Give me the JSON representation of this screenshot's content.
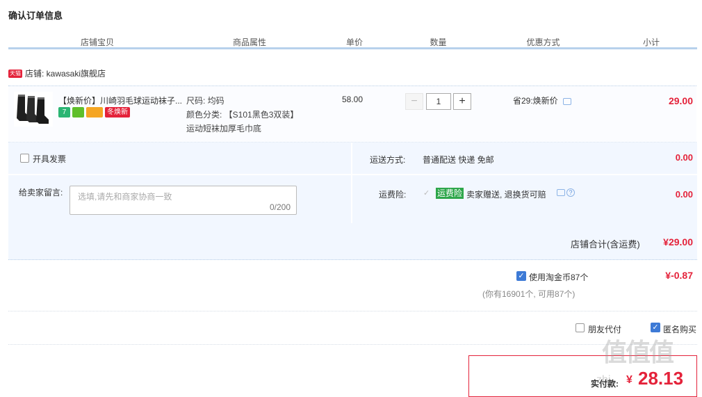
{
  "page": {
    "title": "确认订单信息"
  },
  "table_header": {
    "columns": [
      "店铺宝贝",
      "商品属性",
      "单价",
      "数量",
      "优惠方式",
      "小计"
    ]
  },
  "shop": {
    "badge": "天猫",
    "label": "店铺: kawasaki旗舰店"
  },
  "item": {
    "title": "【焕新价】川崎羽毛球运动袜子...",
    "badges": [
      "7",
      "",
      "",
      "冬焕新"
    ],
    "attr_size": "尺码: 均码",
    "attr_color": "颜色分类: 【S101黑色3双装】",
    "attr_desc": "运动短袜加厚毛巾底",
    "price": "58.00",
    "quantity": "1",
    "minus": "−",
    "plus": "+",
    "discount": "省29:焕新价",
    "subtotal": "29.00"
  },
  "invoice": {
    "label": "开具发票"
  },
  "shipping": {
    "label": "运送方式:",
    "value": "普通配送 快递 免邮",
    "amount": "0.00"
  },
  "message": {
    "label": "给卖家留言:",
    "placeholder": "选填,请先和商家协商一致",
    "counter": "0/200"
  },
  "insurance": {
    "label": "运费险:",
    "tag": "运费险",
    "text": "卖家赠送, 退换货可赔",
    "amount": "0.00",
    "help": "?"
  },
  "shop_total": {
    "label": "店铺合计(含运费)",
    "value": "¥29.00"
  },
  "coins": {
    "label": "使用淘金币87个",
    "note": "(你有16901个, 可用87个)",
    "value": "¥-0.87"
  },
  "options": {
    "friend_pay": "朋友代付",
    "anonymous": "匿名购买"
  },
  "payment": {
    "label": "实付款:",
    "currency": "¥",
    "value": "28.13"
  },
  "watermark": {
    "text": "值值值",
    "domain": "zhi"
  },
  "colors": {
    "accent_red": "#e4223a",
    "header_line": "#b7d1ec",
    "panel_bg": "#f2f7ff",
    "checkbox_blue": "#3d7ad6"
  }
}
